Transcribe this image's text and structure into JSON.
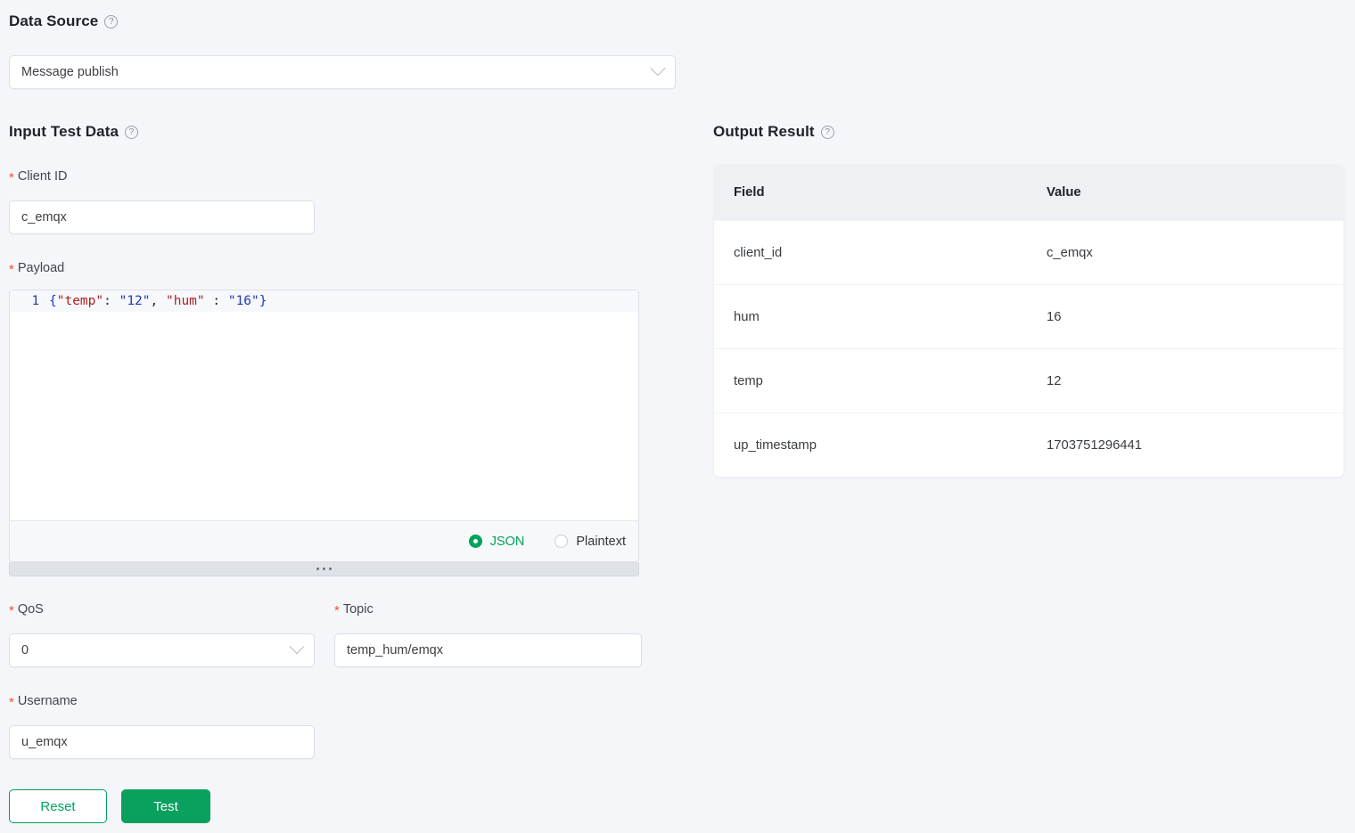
{
  "data_source": {
    "heading": "Data Source",
    "help_icon": "question-circle-icon",
    "selected": "Message publish",
    "chevron_icon": "chevron-down-icon"
  },
  "input_test_data": {
    "heading": "Input Test Data",
    "help_icon": "question-circle-icon",
    "required_marker": "*",
    "client_id": {
      "label": "Client ID",
      "value": "c_emqx"
    },
    "payload": {
      "label": "Payload",
      "line_number": "1",
      "raw": "{\"temp\": \"12\", \"hum\" : \"16\"}",
      "tokens": {
        "open_brace": "{",
        "key_temp": "\"temp\"",
        "colon_1": ":",
        "value_temp": "\"12\"",
        "comma": ",",
        "key_hum": "\"hum\"",
        "colon_2": ":",
        "value_hum": "\"16\"",
        "close_brace": "}"
      },
      "format_options": [
        {
          "label": "JSON",
          "selected": true
        },
        {
          "label": "Plaintext",
          "selected": false
        }
      ],
      "resize_handle_icon": "drag-dots-icon"
    },
    "qos": {
      "label": "QoS",
      "value": "0",
      "chevron_icon": "chevron-down-icon"
    },
    "topic": {
      "label": "Topic",
      "value": "temp_hum/emqx"
    },
    "username": {
      "label": "Username",
      "value": "u_emqx"
    }
  },
  "actions": {
    "reset_label": "Reset",
    "test_label": "Test"
  },
  "output_result": {
    "heading": "Output Result",
    "help_icon": "question-circle-icon",
    "columns": [
      "Field",
      "Value"
    ],
    "rows": [
      {
        "field": "client_id",
        "value": "c_emqx"
      },
      {
        "field": "hum",
        "value": "16"
      },
      {
        "field": "temp",
        "value": "12"
      },
      {
        "field": "up_timestamp",
        "value": "1703751296441"
      }
    ]
  },
  "colors": {
    "page_background": "#f5f6fa",
    "accent_green": "#00a35c",
    "primary_button": "#0aa05e",
    "required_star": "#f5511e",
    "table_header_bg": "#eef0f4",
    "code_key": "#b02020",
    "code_punctuation": "#1b39c4"
  }
}
